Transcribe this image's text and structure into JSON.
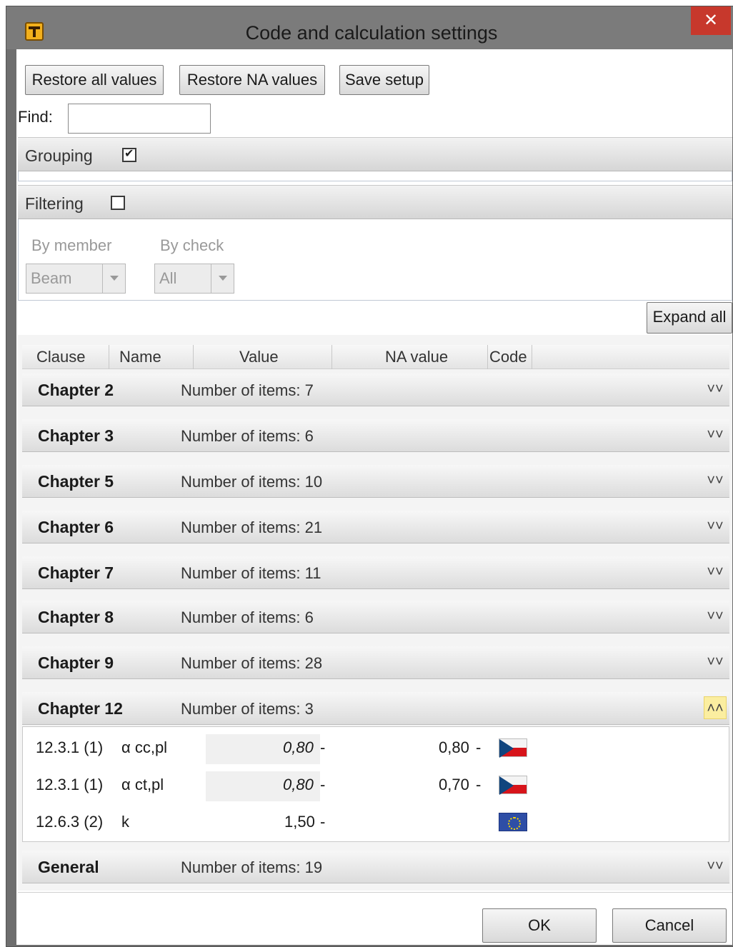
{
  "window": {
    "title": "Code and calculation settings",
    "close_glyph": "✕"
  },
  "toolbar": {
    "restore_all": "Restore all values",
    "restore_na": "Restore NA values",
    "save_setup": "Save setup"
  },
  "find": {
    "label": "Find:",
    "value": ""
  },
  "grouping": {
    "label": "Grouping",
    "checked": true
  },
  "filtering": {
    "label": "Filtering",
    "checked": false,
    "by_member_label": "By member",
    "by_member_value": "Beam",
    "by_check_label": "By check",
    "by_check_value": "All"
  },
  "expand_all": "Expand all",
  "columns": [
    "Clause",
    "Name",
    "Value",
    "NA value",
    "Code"
  ],
  "groups": [
    {
      "title": "Chapter 2",
      "count": "Number of items: 7",
      "expanded": false
    },
    {
      "title": "Chapter 3",
      "count": "Number of items: 6",
      "expanded": false
    },
    {
      "title": "Chapter 5",
      "count": "Number of items: 10",
      "expanded": false
    },
    {
      "title": "Chapter 6",
      "count": "Number of items: 21",
      "expanded": false
    },
    {
      "title": "Chapter 7",
      "count": "Number of items: 11",
      "expanded": false
    },
    {
      "title": "Chapter 8",
      "count": "Number of items: 6",
      "expanded": false
    },
    {
      "title": "Chapter 9",
      "count": "Number of items: 28",
      "expanded": false
    },
    {
      "title": "Chapter 12",
      "count": "Number of items: 3",
      "expanded": true
    },
    {
      "title": "General",
      "count": "Number of items: 19",
      "expanded": false
    }
  ],
  "chapter12_items": [
    {
      "clause": "12.3.1 (1)",
      "name": "α cc,pl",
      "value": "0,80",
      "value_unit": "-",
      "na_value": "0,80",
      "na_unit": "-",
      "code": "cz-flag-icon"
    },
    {
      "clause": "12.3.1 (1)",
      "name": "α ct,pl",
      "value": "0,80",
      "value_unit": "-",
      "na_value": "0,70",
      "na_unit": "-",
      "code": "cz-flag-icon"
    },
    {
      "clause": "12.6.3 (2)",
      "name": "k",
      "value": "1,50",
      "value_unit": "-",
      "na_value": "",
      "na_unit": "",
      "code": "eu-flag-icon"
    }
  ],
  "dialog": {
    "ok": "OK",
    "cancel": "Cancel"
  },
  "icons": {
    "collapsed": "double-chevron-down-icon",
    "expanded": "double-chevron-up-icon",
    "app": "t-app-icon"
  },
  "colors": {
    "title_bar": "#7b7b7b",
    "close_button": "#c7382c",
    "expanded_toggle": "#fbeea0"
  }
}
